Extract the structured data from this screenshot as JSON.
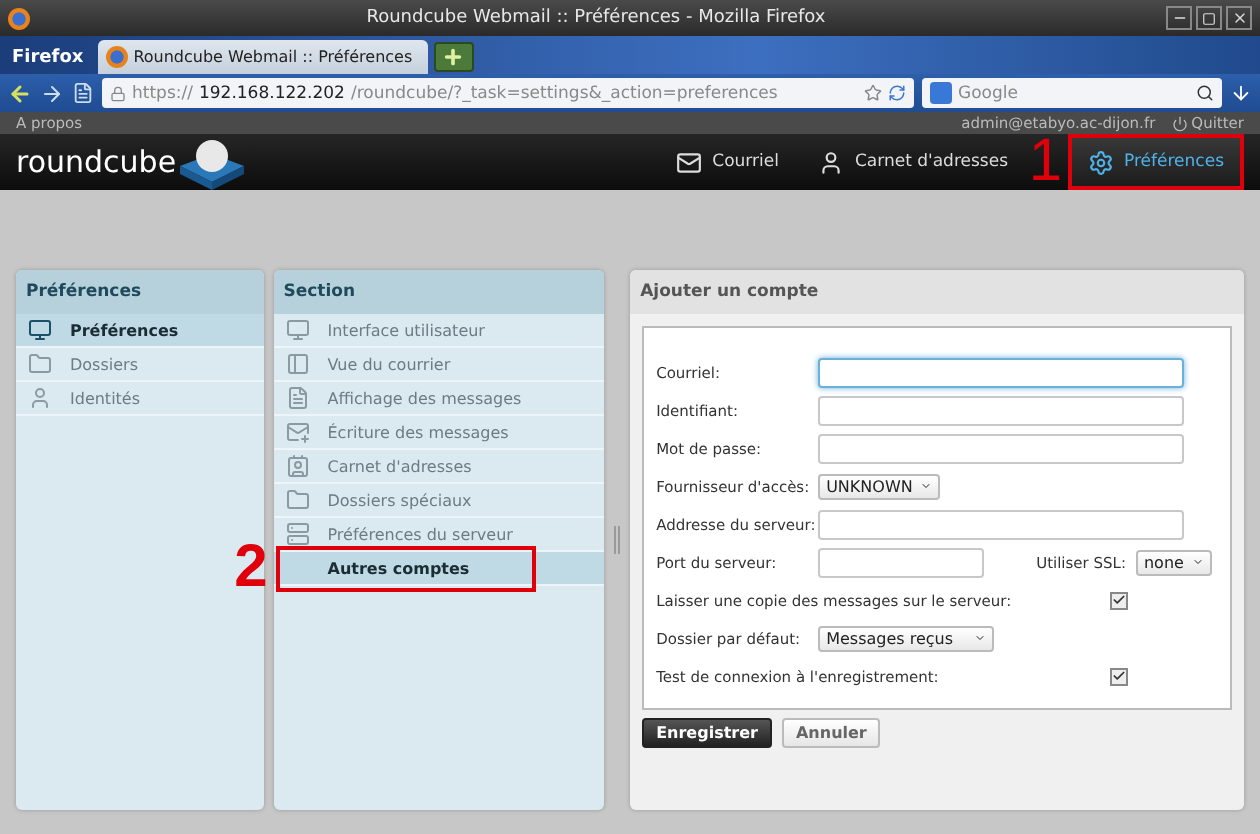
{
  "window": {
    "title": "Roundcube Webmail :: Préférences - Mozilla Firefox"
  },
  "browser": {
    "menu": "Firefox",
    "tab_title": "Roundcube Webmail :: Préférences",
    "url_scheme": "https://",
    "url_host": "192.168.122.202",
    "url_path": "/roundcube/?_task=settings&_action=preferences",
    "search_placeholder": "Google"
  },
  "topbar": {
    "about": "A propos",
    "user": "admin@etabyo.ac-dijon.fr",
    "logout": "Quitter"
  },
  "header": {
    "logo": "roundcube",
    "nav": [
      {
        "label": "Courriel",
        "selected": false
      },
      {
        "label": "Carnet d'adresses",
        "selected": false
      },
      {
        "label": "Préférences",
        "selected": true,
        "annotation": "1"
      }
    ]
  },
  "settings": {
    "title": "Préférences",
    "items": [
      {
        "label": "Préférences",
        "selected": true
      },
      {
        "label": "Dossiers",
        "selected": false
      },
      {
        "label": "Identités",
        "selected": false
      }
    ]
  },
  "section": {
    "title": "Section",
    "items": [
      {
        "label": "Interface utilisateur",
        "selected": false
      },
      {
        "label": "Vue du courrier",
        "selected": false
      },
      {
        "label": "Affichage des messages",
        "selected": false
      },
      {
        "label": "Écriture des messages",
        "selected": false
      },
      {
        "label": "Carnet d'adresses",
        "selected": false
      },
      {
        "label": "Dossiers spéciaux",
        "selected": false
      },
      {
        "label": "Préférences du serveur",
        "selected": false
      },
      {
        "label": "Autres comptes",
        "selected": true,
        "annotation": "2"
      }
    ]
  },
  "form": {
    "title": "Ajouter un compte",
    "fields": [
      {
        "kind": "text",
        "label": "Courriel:",
        "focused": true
      },
      {
        "kind": "text",
        "label": "Identifiant:",
        "focused": false
      },
      {
        "kind": "text",
        "label": "Mot de passe:",
        "focused": false
      },
      {
        "kind": "select",
        "label": "Fournisseur d'accès:",
        "value": "UNKNOWN"
      },
      {
        "kind": "text",
        "label": "Addresse du serveur:",
        "focused": false
      },
      {
        "kind": "port",
        "label": "Port du serveur:",
        "ssl_label": "Utiliser SSL:",
        "ssl_value": "none"
      },
      {
        "kind": "checkbox",
        "label": "Laisser une copie des messages sur le serveur:",
        "checked": true
      },
      {
        "kind": "wideselect",
        "label": "Dossier par défaut:",
        "value": "Messages reçus"
      },
      {
        "kind": "checkbox",
        "label": "Test de connexion à l'enregistrement:",
        "checked": true
      }
    ],
    "buttons": [
      {
        "label": "Enregistrer",
        "kind": "primary"
      },
      {
        "label": "Annuler",
        "kind": "secondary"
      }
    ]
  }
}
